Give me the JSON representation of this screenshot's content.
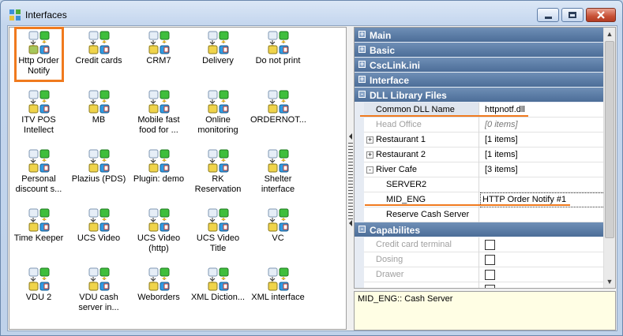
{
  "window": {
    "title": "Interfaces",
    "controls": [
      "minimize",
      "maximize",
      "close"
    ]
  },
  "icons": [
    {
      "label": "Http Order Notify",
      "selected": true,
      "variant": "green"
    },
    {
      "label": "Credit cards",
      "variant": "blue"
    },
    {
      "label": "CRM7",
      "variant": "blue"
    },
    {
      "label": "Delivery",
      "variant": "blue"
    },
    {
      "label": "Do not print",
      "variant": "blue"
    },
    {
      "label": "ITV POS Intellect",
      "variant": "blue"
    },
    {
      "label": "MB",
      "variant": "blue"
    },
    {
      "label": "Mobile fast food for ...",
      "variant": "blue"
    },
    {
      "label": "Online monitoring",
      "variant": "blue"
    },
    {
      "label": "ORDERNOT...",
      "variant": "blue"
    },
    {
      "label": "Personal discount s...",
      "variant": "blue"
    },
    {
      "label": "Plazius (PDS)",
      "variant": "blue"
    },
    {
      "label": "Plugin: demo",
      "variant": "blue"
    },
    {
      "label": "RK Reservation",
      "variant": "blue"
    },
    {
      "label": "Shelter interface",
      "variant": "blue"
    },
    {
      "label": "Time Keeper",
      "variant": "blue"
    },
    {
      "label": "UCS Video",
      "variant": "blue"
    },
    {
      "label": "UCS Video (http)",
      "variant": "blue"
    },
    {
      "label": "UCS Video Title",
      "variant": "blue"
    },
    {
      "label": "VC",
      "variant": "blue"
    },
    {
      "label": "VDU 2",
      "variant": "blue"
    },
    {
      "label": "VDU cash server in...",
      "variant": "blue"
    },
    {
      "label": "Weborders",
      "variant": "blue"
    },
    {
      "label": "XML Diction...",
      "variant": "blue"
    },
    {
      "label": "XML interface",
      "variant": "blue"
    }
  ],
  "propgrid": {
    "rows": [
      {
        "kind": "cat",
        "label": "Main",
        "expander": "+"
      },
      {
        "kind": "cat",
        "label": "Basic",
        "expander": "+"
      },
      {
        "kind": "cat",
        "label": "CscLink.ini",
        "expander": "+"
      },
      {
        "kind": "cat",
        "label": "Interface",
        "expander": "+"
      },
      {
        "kind": "cat",
        "label": "DLL Library Files",
        "expander": "-"
      },
      {
        "kind": "prop",
        "name": "Common DLL Name",
        "value": "httpnotf.dll",
        "selected": true
      },
      {
        "kind": "prop",
        "name": "Head Office",
        "value": "[0 items]",
        "gray": true
      },
      {
        "kind": "prop",
        "name": "Restaurant 1",
        "value": "[1 items]",
        "expander": "+",
        "indent": 0
      },
      {
        "kind": "prop",
        "name": "Restaurant 2",
        "value": "[1 items]",
        "expander": "+",
        "indent": 0
      },
      {
        "kind": "prop",
        "name": "River Cafe",
        "value": "[3 items]",
        "expander": "-",
        "indent": 0
      },
      {
        "kind": "prop",
        "name": "SERVER2",
        "value": "",
        "indent": 1
      },
      {
        "kind": "prop",
        "name": "MID_ENG",
        "value": "HTTP Order Notify #1",
        "indent": 1,
        "editing": true
      },
      {
        "kind": "prop",
        "name": "Reserve Cash Server",
        "value": "",
        "indent": 1
      },
      {
        "kind": "cat",
        "label": "Capabilites",
        "expander": "-"
      },
      {
        "kind": "prop",
        "name": "Credit card terminal",
        "value": "",
        "gray": true,
        "checkbox": true
      },
      {
        "kind": "prop",
        "name": "Dosing",
        "value": "",
        "gray": true,
        "checkbox": true
      },
      {
        "kind": "prop",
        "name": "Drawer",
        "value": "",
        "gray": true,
        "checkbox": true
      },
      {
        "kind": "prop",
        "name": "",
        "value": "",
        "gray": true,
        "checkbox": true
      }
    ]
  },
  "description": {
    "text": "MID_ENG:: Cash Server"
  },
  "colors": {
    "highlight": "#f07a1e",
    "category_bg": "#5b7ba6",
    "description_bg": "#fffee4"
  }
}
